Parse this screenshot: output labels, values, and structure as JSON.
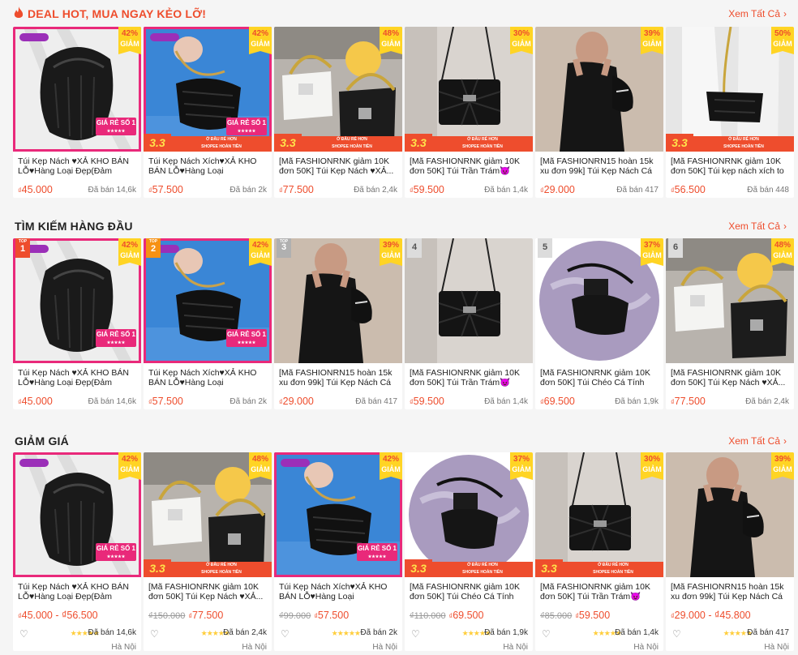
{
  "sections": [
    {
      "title": "DEAL HOT, MUA NGAY KẺO LỠ!",
      "see_all": "Xem Tất Cả",
      "products": [
        {
          "name": "Túi Kẹp Nách ♥XẢ KHO BÁN LỖ♥Hàng Loại Đẹp(Đảm Bảo...",
          "price": "45.000",
          "sold": "Đã bán 14,6k",
          "discount": "42%",
          "discount_label": "GIẢM",
          "image": "white-bg-black-ruched-bag",
          "promo": "gia-re"
        },
        {
          "name": "Túi Kẹp Nách Xích♥XẢ KHO BÁN LỖ♥Hàng Loại Đẹp(Đảm...",
          "price": "57.500",
          "sold": "Đã bán 2k",
          "discount": "42%",
          "discount_label": "GIẢM",
          "image": "blue-bg-croc-bag",
          "promo": "both"
        },
        {
          "name": "[Mã FASHIONRNK giảm 10K đơn 50K] Túi Kẹp Nách ♥XẢ...",
          "price": "77.500",
          "sold": "Đã bán 2,4k",
          "discount": "48%",
          "discount_label": "GIẢM",
          "image": "white-black-chain-bags",
          "promo": "33"
        },
        {
          "name": "[Mã FASHIONRNK giảm 10K đơn 50K] Túi Trần Trám😈Giá...",
          "price": "59.500",
          "sold": "Đã bán 1,4k",
          "discount": "30%",
          "discount_label": "GIẢM",
          "image": "quilted-black-bag",
          "promo": "33"
        },
        {
          "name": "[Mã FASHIONRN15 hoàn 15k xu đơn 99k] Túi Kẹp Nách Cá Tính",
          "price": "29.000",
          "sold": "Đã bán 417",
          "discount": "39%",
          "discount_label": "GIẢM",
          "image": "model-black-dress",
          "promo": "none"
        },
        {
          "name": "[Mã FASHIONRNK giảm 10K đơn 50K] Túi kẹp nách xích to",
          "price": "56.500",
          "sold": "Đã bán 448",
          "discount": "50%",
          "discount_label": "GIẢM",
          "image": "white-coat-croc-bag",
          "promo": "33"
        }
      ]
    },
    {
      "title": "TÌM KIẾM HÀNG ĐẦU",
      "see_all": "Xem Tất Cả",
      "products": [
        {
          "rank": "1",
          "name": "Túi Kẹp Nách ♥XẢ KHO BÁN LỖ♥Hàng Loại Đẹp(Đảm Bảo...",
          "price": "45.000",
          "sold": "Đã bán 14,6k",
          "discount": "42%",
          "discount_label": "GIẢM",
          "image": "white-bg-black-ruched-bag",
          "promo": "gia-re"
        },
        {
          "rank": "2",
          "name": "Túi Kẹp Nách Xích♥XẢ KHO BÁN LỖ♥Hàng Loại Đẹp(Đảm...",
          "price": "57.500",
          "sold": "Đã bán 2k",
          "discount": "42%",
          "discount_label": "GIẢM",
          "image": "blue-bg-croc-bag",
          "promo": "gia-re"
        },
        {
          "rank": "3",
          "name": "[Mã FASHIONRN15 hoàn 15k xu đơn 99k] Túi Kẹp Nách Cá Tính",
          "price": "29.000",
          "sold": "Đã bán 417",
          "discount": "39%",
          "discount_label": "GIẢM",
          "image": "model-black-dress",
          "promo": "none"
        },
        {
          "rank": "4",
          "name": "[Mã FASHIONRNK giảm 10K đơn 50K] Túi Trần Trám😈Giá...",
          "price": "59.500",
          "sold": "Đã bán 1,4k",
          "discount": "",
          "discount_label": "",
          "image": "quilted-black-bag",
          "promo": "none"
        },
        {
          "rank": "5",
          "name": "[Mã FASHIONRNK giảm 10K đơn 50K] Túi Chéo Cá Tính 2i...",
          "price": "69.500",
          "sold": "Đã bán 1,9k",
          "discount": "37%",
          "discount_label": "GIẢM",
          "image": "purple-fabric-bag",
          "promo": "none"
        },
        {
          "rank": "6",
          "name": "[Mã FASHIONRNK giảm 10K đơn 50K] Túi Kẹp Nách ♥XẢ...",
          "price": "77.500",
          "sold": "Đã bán 2,4k",
          "discount": "48%",
          "discount_label": "GIẢM",
          "image": "white-black-chain-bags",
          "promo": "none"
        }
      ]
    },
    {
      "title": "GIẢM GIÁ",
      "see_all": "Xem Tất Cả",
      "products": [
        {
          "name": "Túi Kẹp Nách ♥XẢ KHO BÁN LỖ♥Hàng Loại Đẹp(Đảm Bảo...",
          "old_price": "",
          "price": "45.000 - ₫56.500",
          "sold": "Đã bán 14,6k",
          "location": "Hà Nội",
          "discount": "42%",
          "discount_label": "GIẢM",
          "image": "white-bg-black-ruched-bag",
          "promo": "gia-re"
        },
        {
          "name": "[Mã FASHIONRNK giảm 10K đơn 50K] Túi Kẹp Nách ♥XẢ...",
          "old_price": "₫150.000",
          "price": "77.500",
          "sold": "Đã bán 2,4k",
          "location": "Hà Nội",
          "discount": "48%",
          "discount_label": "GIẢM",
          "image": "white-black-chain-bags",
          "promo": "33"
        },
        {
          "name": "Túi Kẹp Nách Xích♥XẢ KHO BÁN LỖ♥Hàng Loại Đẹp(Đảm...",
          "old_price": "₫99.000",
          "price": "57.500",
          "sold": "Đã bán 2k",
          "location": "Hà Nội",
          "discount": "42%",
          "discount_label": "GIẢM",
          "image": "blue-bg-croc-bag",
          "promo": "gia-re"
        },
        {
          "name": "[Mã FASHIONRNK giảm 10K đơn 50K] Túi Chéo Cá Tính 2i...",
          "old_price": "₫110.000",
          "price": "69.500",
          "sold": "Đã bán 1,9k",
          "location": "Hà Nội",
          "discount": "37%",
          "discount_label": "GIẢM",
          "image": "purple-fabric-bag",
          "promo": "33"
        },
        {
          "name": "[Mã FASHIONRNK giảm 10K đơn 50K] Túi Trần Trám😈Giá...",
          "old_price": "₫85.000",
          "price": "59.500",
          "sold": "Đã bán 1,4k",
          "location": "Hà Nội",
          "discount": "30%",
          "discount_label": "GIẢM",
          "image": "quilted-black-bag",
          "promo": "33"
        },
        {
          "name": "[Mã FASHIONRN15 hoàn 15k xu đơn 99k] Túi Kẹp Nách Cá Tính",
          "old_price": "",
          "price": "29.000 - ₫45.800",
          "sold": "Đã bán 417",
          "location": "Hà Nội",
          "discount": "39%",
          "discount_label": "GIẢM",
          "image": "model-black-dress",
          "promo": "none"
        }
      ]
    }
  ],
  "promo_text": {
    "giare_big": "GIÁ RẺ SỐ 1",
    "giare_small": "★★★★★",
    "b33": "3.3",
    "bar_line1": "Ở ĐÂU RẺ HƠN",
    "bar_line2": "SHOPEE HOÀN TIỀN",
    "top": "TOP"
  },
  "currency": "₫",
  "stars": "★★★★★",
  "colors": {
    "accent": "#ee4d2d",
    "discount_bg": "#ffd424",
    "frame_pink": "#e9297a"
  }
}
